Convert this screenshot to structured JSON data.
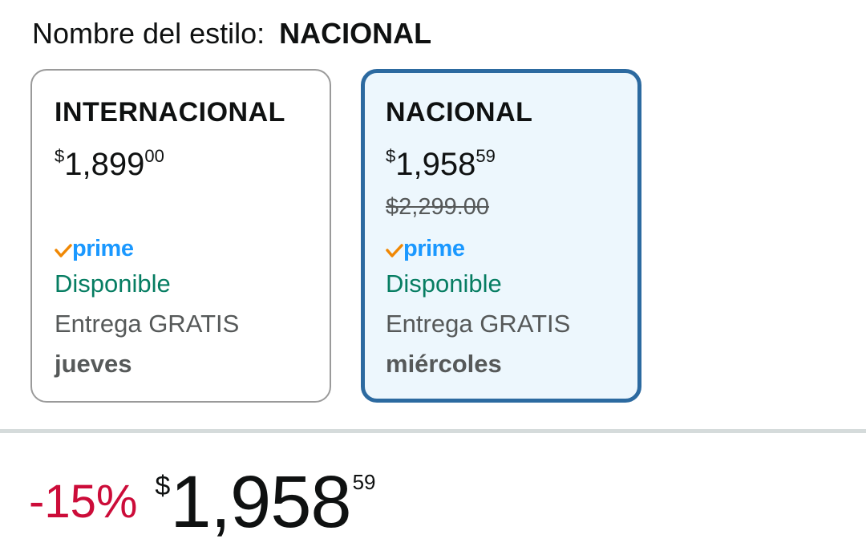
{
  "style": {
    "label": "Nombre del estilo:",
    "value": "NACIONAL"
  },
  "options": [
    {
      "title": "INTERNACIONAL",
      "price_symbol": "$",
      "price_whole": "1,899",
      "price_cents": "00",
      "list_price": "",
      "prime_word": "prime",
      "availability": "Disponible",
      "delivery": "Entrega GRATIS",
      "delivery_day": "jueves",
      "selected": false
    },
    {
      "title": "NACIONAL",
      "price_symbol": "$",
      "price_whole": "1,958",
      "price_cents": "59",
      "list_price": "$2,299.00",
      "prime_word": "prime",
      "availability": "Disponible",
      "delivery": "Entrega GRATIS",
      "delivery_day": "miércoles",
      "selected": true
    }
  ],
  "price": {
    "discount": "-15%",
    "symbol": "$",
    "whole": "1,958",
    "cents": "59"
  },
  "colors": {
    "selected_border": "#2c6aa0",
    "selected_bg": "#edf7fd",
    "prime_blue": "#1a98ff",
    "prime_check": "#f08804",
    "available_green": "#067d62",
    "discount_red": "#cc0c39"
  },
  "icons": {
    "prime": "prime-check-icon"
  }
}
